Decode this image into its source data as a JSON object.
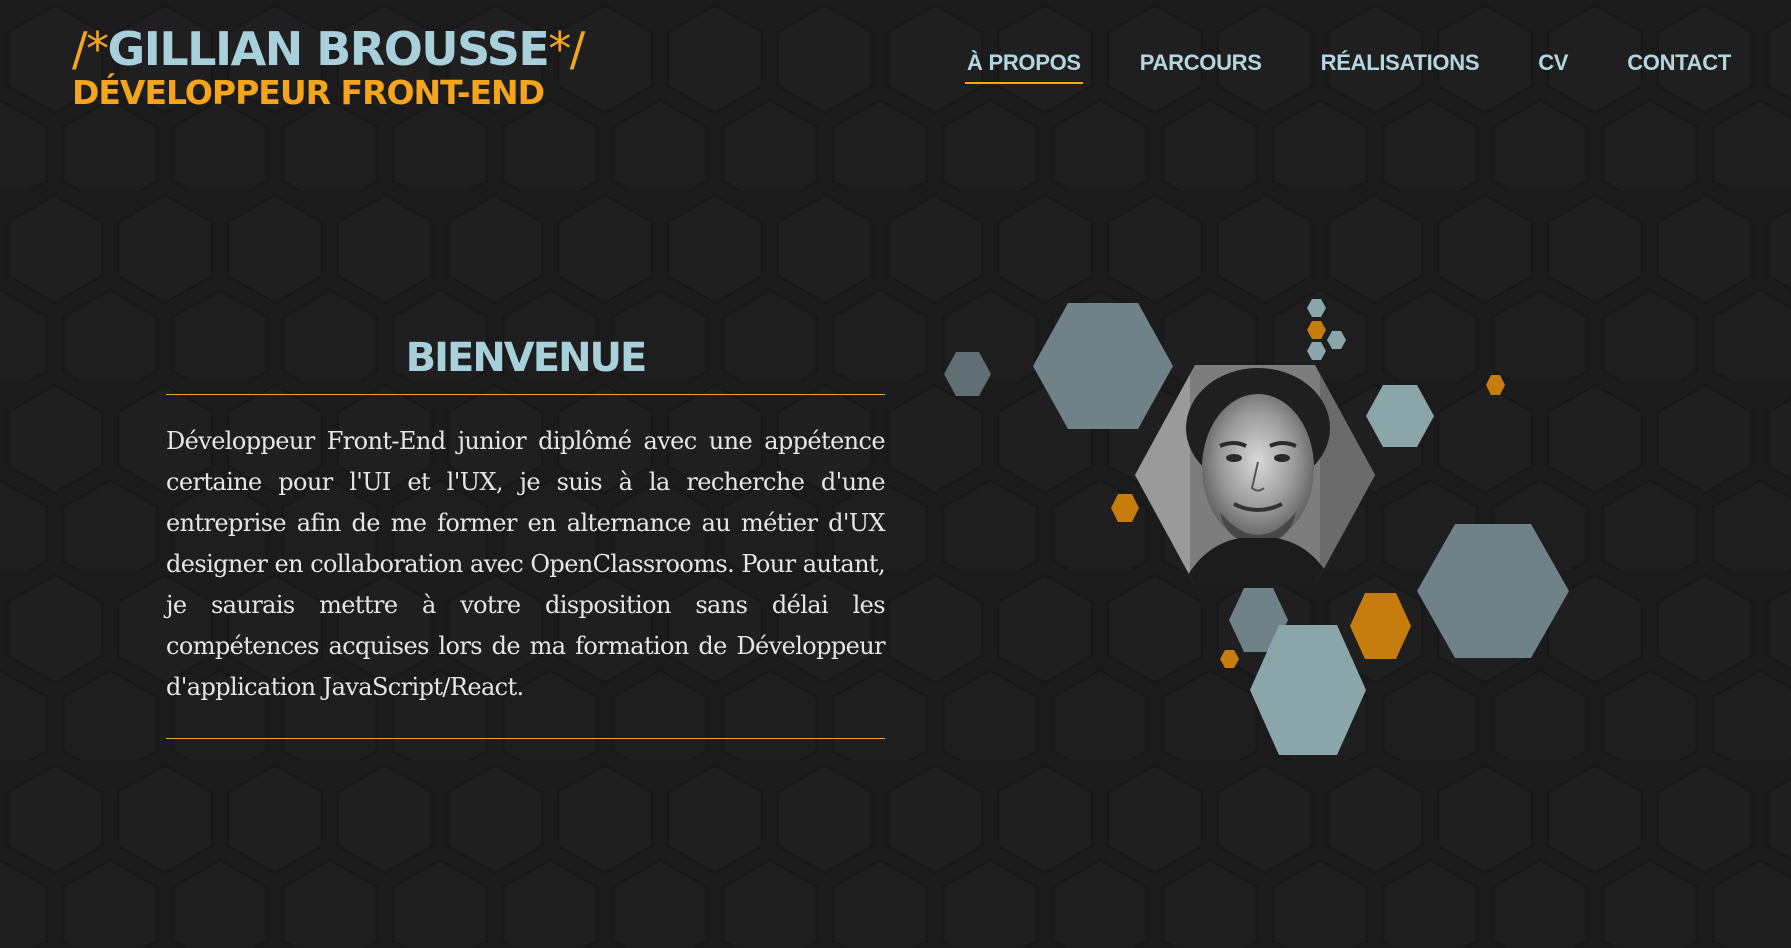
{
  "header": {
    "logo": {
      "name_open": "/*",
      "name": "GILLIAN BROUSSE",
      "name_close": "*/",
      "subtitle": "DÉVELOPPEUR FRONT-END"
    },
    "nav": [
      {
        "label": "À PROPOS",
        "active": true
      },
      {
        "label": "PARCOURS",
        "active": false
      },
      {
        "label": "RÉALISATIONS",
        "active": false
      },
      {
        "label": "CV",
        "active": false
      },
      {
        "label": "CONTACT",
        "active": false
      }
    ]
  },
  "intro": {
    "title": "BIENVENUE",
    "text": "Développeur Front-End junior diplômé avec une appétence certaine pour l'UI et l'UX, je suis à la recherche d'une entreprise afin de me former en alternance au métier d'UX designer en collaboration avec OpenClassrooms. Pour autant, je saurais mettre à votre disposition sans délai les compétences acquises lors de ma formation de Développeur d'application JavaScript/React."
  },
  "colors": {
    "background": "#1c1b1b",
    "accent": "#f4a51c",
    "title_blue": "#a7d0db",
    "hex_gray": "#6f8287",
    "hex_light": "#8aa6ab",
    "hex_orange": "#c67d0e"
  }
}
